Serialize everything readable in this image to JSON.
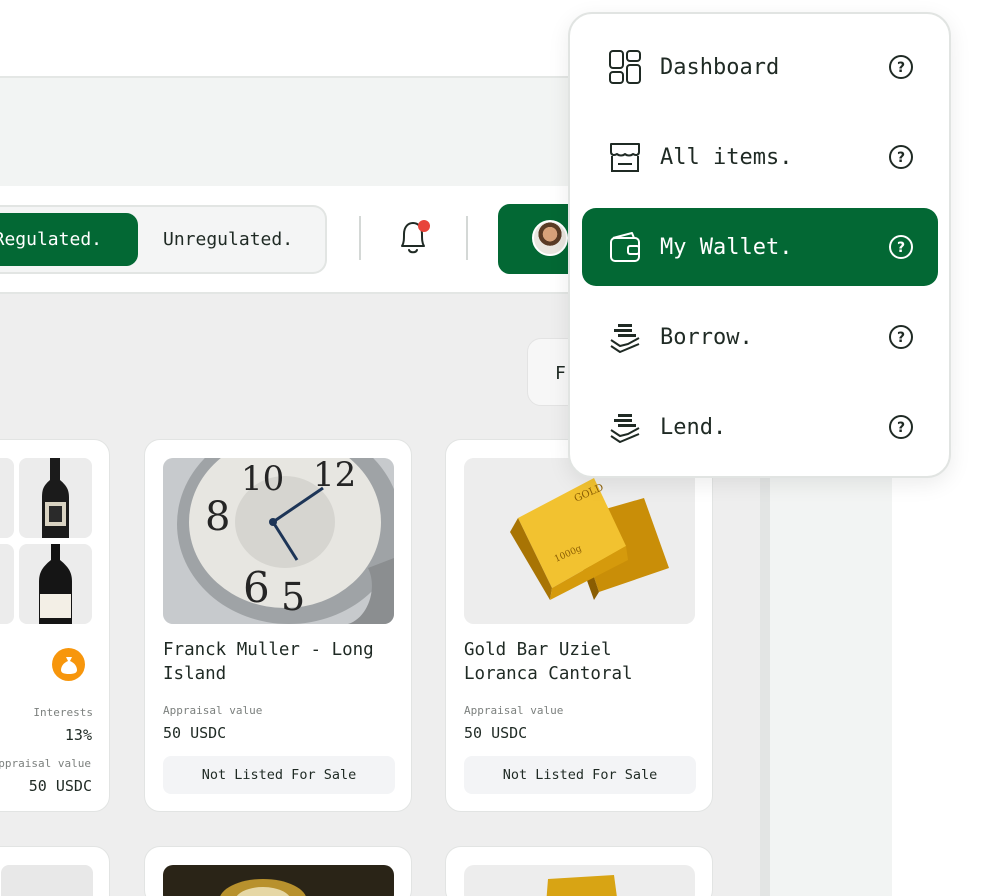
{
  "header": {
    "toggle": {
      "active": "Regulated.",
      "inactive": "Unregulated."
    },
    "filter_label": "F"
  },
  "menu": {
    "items": [
      {
        "label": "Dashboard",
        "icon": "grid-icon",
        "active": false
      },
      {
        "label": "All items.",
        "icon": "store-icon",
        "active": false
      },
      {
        "label": "My Wallet.",
        "icon": "wallet-icon",
        "active": true
      },
      {
        "label": "Borrow.",
        "icon": "coins-hand-icon",
        "active": false
      },
      {
        "label": "Lend.",
        "icon": "coins-hand-icon",
        "active": false
      }
    ],
    "help_icon": "question-circle-icon"
  },
  "left_card": {
    "interests_label": "Interests",
    "interests_value": "13%",
    "appraisal_label": "Appraisal value",
    "appraisal_value": "50 USDC"
  },
  "cards": [
    {
      "title": "Franck Muller - Long Island",
      "appraisal_label": "Appraisal value",
      "appraisal_value": "50 USDC",
      "status": "Not Listed For Sale"
    },
    {
      "title": "Gold Bar Uziel Loranca Cantoral",
      "appraisal_label": "Appraisal value",
      "appraisal_value": "50 USDC",
      "status": "Not Listed For Sale"
    }
  ],
  "colors": {
    "brand_green": "#036834",
    "notification_dot": "#e8443a",
    "coin_orange": "#f7960c"
  }
}
